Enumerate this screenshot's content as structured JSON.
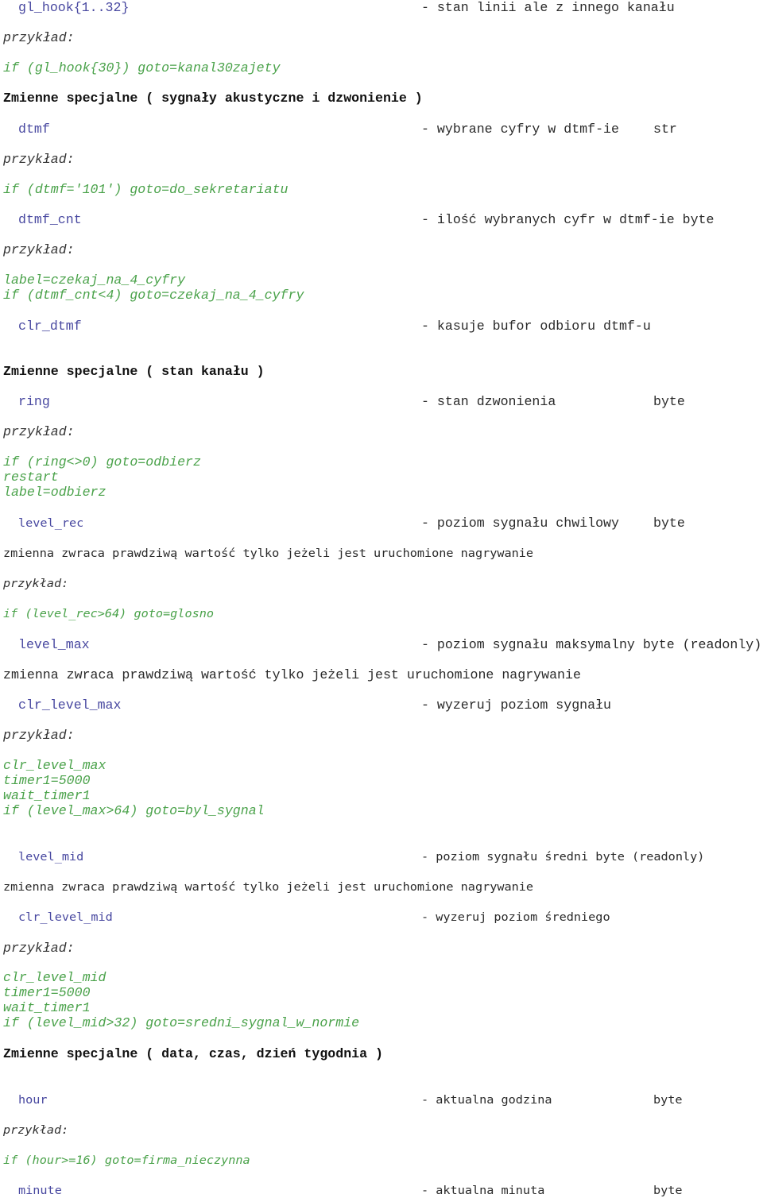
{
  "example_label": "przykład:",
  "entries": [
    {
      "name": "gl_hook{1..32}",
      "desc": "- stan linii ale z innego kanału"
    },
    {
      "code": [
        "if (gl_hook{30}) goto=kanal30zajety"
      ]
    },
    {
      "header": "Zmienne specjalne ( sygnały akustyczne i dzwonienie )"
    },
    {
      "name": "dtmf",
      "desc": "- wybrane cyfry w dtmf-ie",
      "type": "str"
    },
    {
      "code": [
        "if (dtmf='101') goto=do_sekretariatu"
      ]
    },
    {
      "name": "dtmf_cnt",
      "desc": "- ilość wybranych cyfr w dtmf-ie byte"
    },
    {
      "code": [
        "label=czekaj_na_4_cyfry",
        "if (dtmf_cnt<4) goto=czekaj_na_4_cyfry"
      ]
    },
    {
      "name": "clr_dtmf",
      "desc": "- kasuje bufor odbioru dtmf-u"
    },
    {
      "header": "Zmienne specjalne ( stan kanału )"
    },
    {
      "name": "ring",
      "desc": "- stan dzwonienia",
      "type": "byte"
    },
    {
      "code": [
        "if (ring<>0) goto=odbierz",
        "restart",
        "label=odbierz"
      ]
    },
    {
      "name": "level_rec",
      "desc": "- poziom sygnału chwilowy",
      "type": "byte"
    },
    {
      "note": "zmienna zwraca prawdziwą wartość tylko jeżeli jest uruchomione nagrywanie"
    },
    {
      "code": [
        "if (level_rec>64) goto=glosno"
      ]
    },
    {
      "name": "level_max",
      "desc": "- poziom sygnału maksymalny byte (readonly)"
    },
    {
      "note": "zmienna zwraca prawdziwą wartość tylko jeżeli jest uruchomione nagrywanie"
    },
    {
      "name": "clr_level_max",
      "desc": "- wyzeruj poziom sygnału"
    },
    {
      "code": [
        "clr_level_max",
        "timer1=5000",
        "wait_timer1",
        "if (level_max>64) goto=byl_sygnal"
      ]
    },
    {
      "name": "level_mid",
      "desc": "- poziom sygnału średni byte (readonly)"
    },
    {
      "note": "zmienna zwraca prawdziwą wartość tylko jeżeli jest uruchomione nagrywanie"
    },
    {
      "name": "clr_level_mid",
      "desc": "- wyzeruj poziom średniego"
    },
    {
      "code": [
        "clr_level_mid",
        "timer1=5000",
        "wait_timer1",
        "if (level_mid>32) goto=sredni_sygnal_w_normie"
      ]
    },
    {
      "header": "Zmienne specjalne ( data, czas, dzień tygodnia )"
    },
    {
      "name": "hour",
      "desc": "- aktualna godzina",
      "type": "byte"
    },
    {
      "code": [
        "if (hour>=16) goto=firma_nieczynna"
      ]
    },
    {
      "name": "minute",
      "desc": "- aktualna minuta",
      "type": "byte"
    }
  ]
}
